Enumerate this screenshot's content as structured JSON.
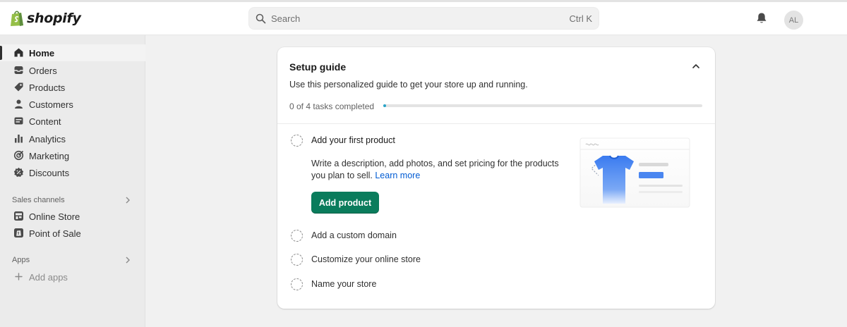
{
  "topbar": {
    "brand": "shopify",
    "search_placeholder": "Search",
    "search_shortcut": "Ctrl K",
    "avatar_initials": "AL",
    "icons": {
      "logo": "shopify-bag-icon",
      "search": "search-icon",
      "notifications": "bell-icon"
    }
  },
  "sidebar": {
    "items": [
      {
        "label": "Home",
        "icon": "home-icon",
        "active": true
      },
      {
        "label": "Orders",
        "icon": "inbox-icon"
      },
      {
        "label": "Products",
        "icon": "tag-icon"
      },
      {
        "label": "Customers",
        "icon": "person-icon"
      },
      {
        "label": "Content",
        "icon": "content-icon"
      },
      {
        "label": "Analytics",
        "icon": "bar-chart-icon"
      },
      {
        "label": "Marketing",
        "icon": "target-icon"
      },
      {
        "label": "Discounts",
        "icon": "discount-icon"
      }
    ],
    "sales_channels": {
      "label": "Sales channels",
      "items": [
        {
          "label": "Online Store",
          "icon": "storefront-icon"
        },
        {
          "label": "Point of Sale",
          "icon": "pos-icon"
        }
      ]
    },
    "apps": {
      "label": "Apps",
      "add_label": "Add apps"
    },
    "colors": {
      "active_bar": "#303030",
      "accent_green": "#0a7c5c"
    }
  },
  "setup_guide": {
    "title": "Setup guide",
    "description": "Use this personalized guide to get your store up and running.",
    "progress_text": "0 of 4 tasks completed",
    "progress_completed": 0,
    "progress_total": 4,
    "tasks": [
      {
        "label": "Add your first product",
        "expanded": true,
        "description": "Write a description, add photos, and set pricing for the products you plan to sell.",
        "link": "Learn more",
        "button": "Add product"
      },
      {
        "label": "Add a custom domain"
      },
      {
        "label": "Customize your online store"
      },
      {
        "label": "Name your store"
      }
    ],
    "colors": {
      "progress": "#29a3c7",
      "link": "#005bd3",
      "button": "#0a7c5c",
      "tshirt": "#3a7bf0"
    }
  }
}
